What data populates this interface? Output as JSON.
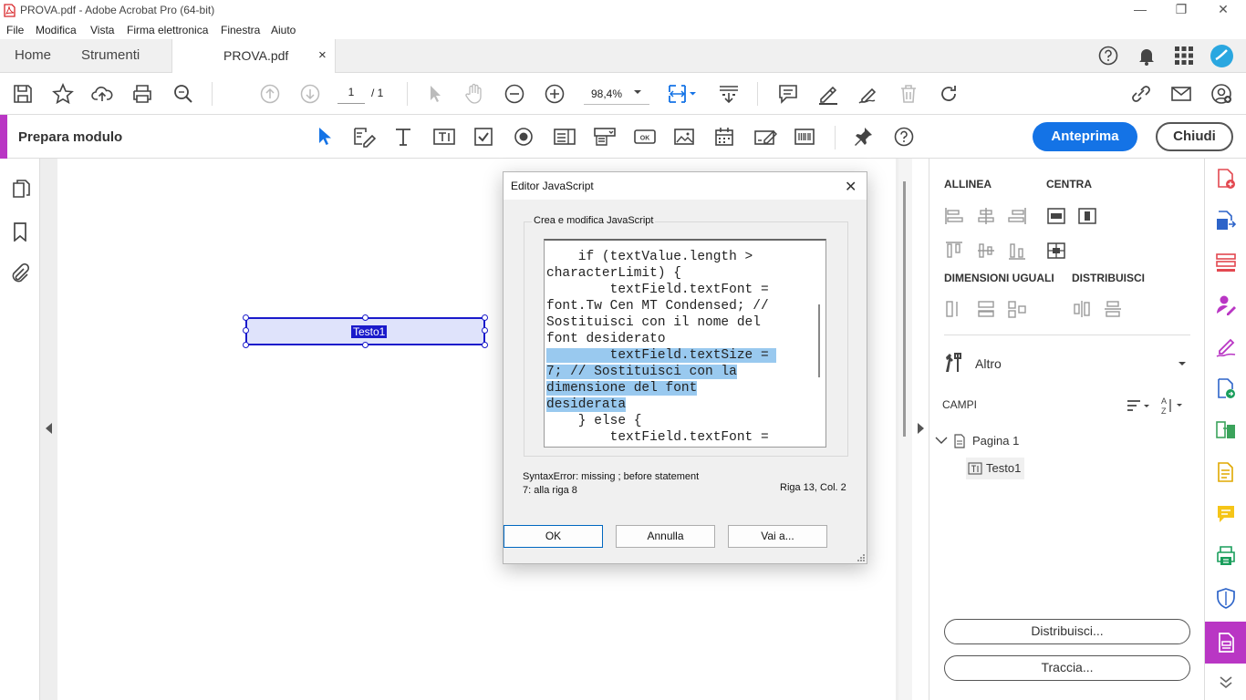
{
  "window": {
    "title": "PROVA.pdf - Adobe Acrobat Pro (64-bit)",
    "minimize": "—",
    "restore": "❐",
    "close": "✕"
  },
  "menu": [
    "File",
    "Modifica",
    "Vista",
    "Firma elettronica",
    "Finestra",
    "Aiuto"
  ],
  "tabs": {
    "home": "Home",
    "tools": "Strumenti",
    "document": "PROVA.pdf",
    "close_glyph": "×"
  },
  "toolbar": {
    "page_current": "1",
    "page_total": "/ 1",
    "zoom": "98,4%"
  },
  "formbar": {
    "title": "Prepara modulo",
    "preview_button": "Anteprima",
    "close_button": "Chiudi"
  },
  "document": {
    "field_label": "Testo1"
  },
  "right_panel": {
    "align": "ALLINEA",
    "center": "CENTRA",
    "match_size": "DIMENSIONI UGUALI",
    "distribute": "DISTRIBUISCI",
    "more": "Altro",
    "fields": "CAMPI",
    "page_node": "Pagina 1",
    "field_node": "Testo1",
    "distribute_button": "Distribuisci...",
    "track_button": "Traccia..."
  },
  "dialog": {
    "title": "Editor JavaScript",
    "group_label": "Crea e modifica JavaScript",
    "code_before": "    if (textValue.length >\ncharacterLimit) {\n        textField.textFont =\nfont.Tw Cen MT Condensed; //\nSostituisci con il nome del\nfont desiderato\n",
    "code_selected": "        textField.textSize = \n7; // Sostituisci con la\ndimensione del font\ndesiderata",
    "code_after": "\n    } else {\n        textField.textFont =",
    "error_line1": "SyntaxError: missing ; before statement",
    "error_line2": "7: alla riga 8",
    "position": "Riga 13, Col. 2",
    "ok": "OK",
    "cancel": "Annulla",
    "goto": "Vai a..."
  },
  "colors": {
    "accent_blue": "#1473e6",
    "form_accent": "#b936c4",
    "field_border": "#1a1acb",
    "selection": "#99c9ef"
  }
}
